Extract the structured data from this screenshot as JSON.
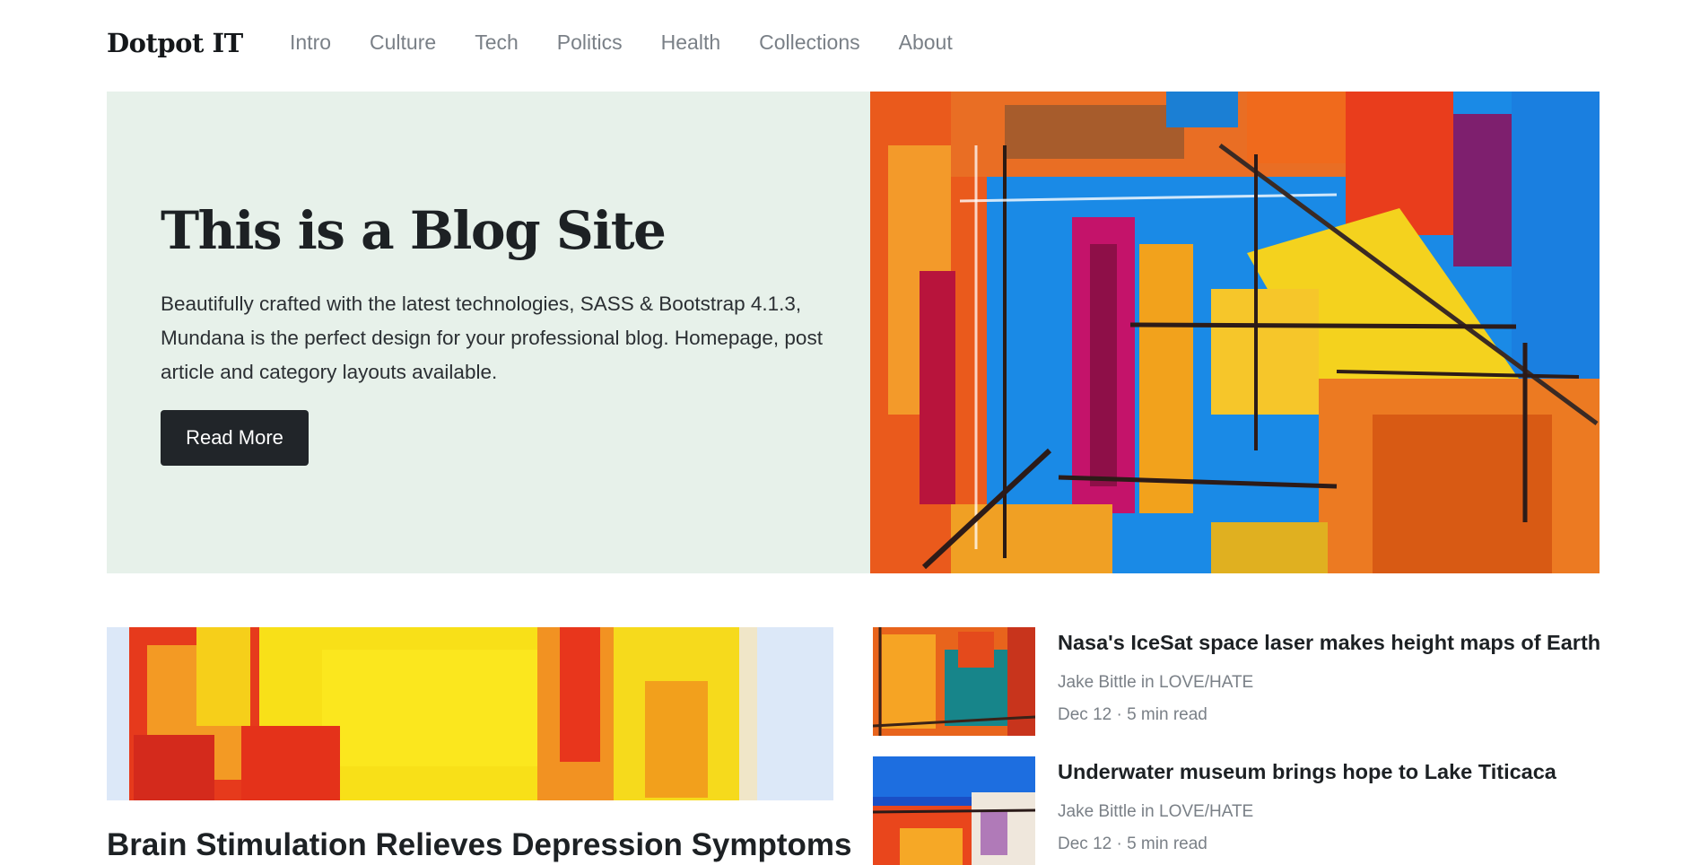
{
  "brand": "Dotpot IT",
  "nav": {
    "items": [
      {
        "label": "Intro"
      },
      {
        "label": "Culture"
      },
      {
        "label": "Tech"
      },
      {
        "label": "Politics"
      },
      {
        "label": "Health"
      },
      {
        "label": "Collections"
      },
      {
        "label": "About"
      }
    ]
  },
  "hero": {
    "title": "This is a Blog Site",
    "description": "Beautifully crafted with the latest technologies, SASS & Bootstrap 4.1.3, Mundana is the perfect design for your professional blog. Homepage, post article and category layouts available.",
    "button_label": "Read More"
  },
  "featured": {
    "title": "Brain Stimulation Relieves Depression Symptoms"
  },
  "posts": [
    {
      "title": "Nasa's IceSat space laser makes height maps of Earth",
      "author": "Jake Bittle in LOVE/HATE",
      "meta": "Dec 12 · 5 min read"
    },
    {
      "title": "Underwater museum brings hope to Lake Titicaca",
      "author": "Jake Bittle in LOVE/HATE",
      "meta": "Dec 12 · 5 min read"
    }
  ],
  "colors": {
    "hero_background": "#e7f1ea",
    "button_background": "#212529",
    "nav_text": "#7a8087",
    "heading_text": "#1d2124"
  }
}
